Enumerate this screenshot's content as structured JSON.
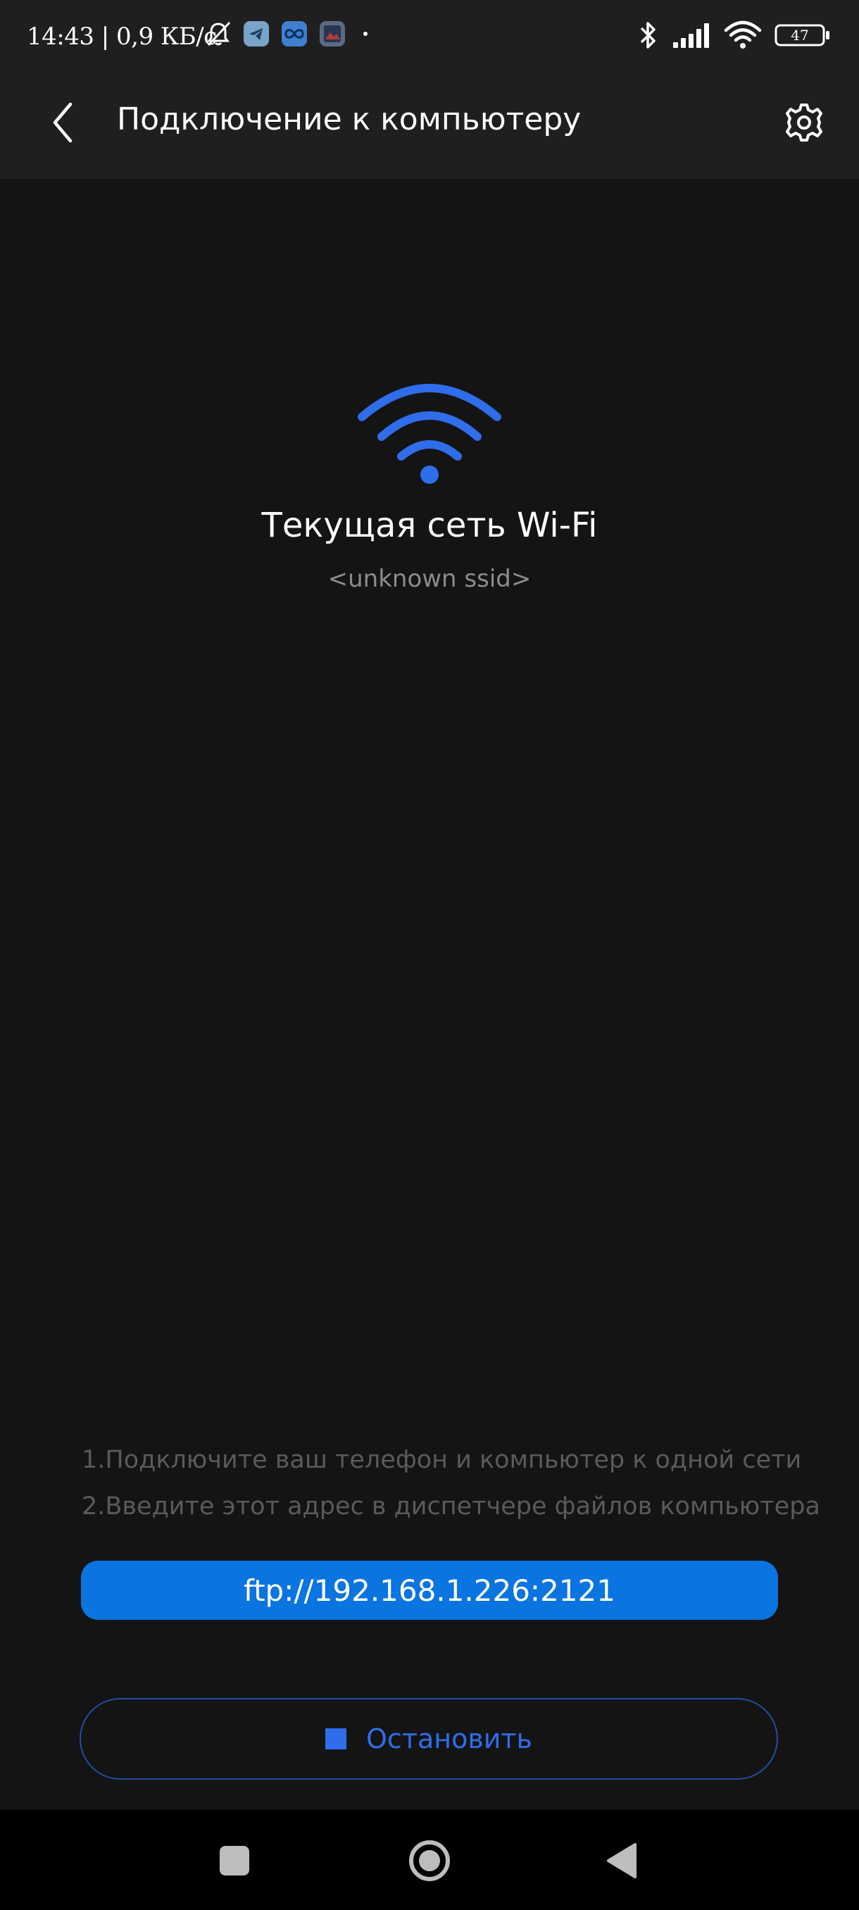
{
  "status_bar": {
    "time_speed": "14:43 | 0,9 КБ/с",
    "battery": "47",
    "icons_left": [
      "muted-alarm-icon",
      "telegram-icon",
      "infinity-app-icon",
      "photo-app-icon"
    ],
    "icons_right": [
      "bluetooth-icon",
      "signal-icon",
      "wifi-icon",
      "battery-icon"
    ]
  },
  "header": {
    "title": "Подключение к компьютеру",
    "back_icon": "chevron-left-icon",
    "settings_icon": "gear-icon"
  },
  "wifi": {
    "title": "Текущая сеть Wi-Fi",
    "ssid": "<unknown ssid>",
    "icon": "wifi-icon",
    "accent_color": "#2f6dea"
  },
  "instructions": [
    "1.Подключите ваш телефон и компьютер к одной сети",
    "2.Введите этот адрес в диспетчере файлов компьютера"
  ],
  "address": {
    "value": "ftp://192.168.1.226:2121",
    "color": "#0a74e0"
  },
  "stop_button": {
    "label": "Остановить",
    "icon": "stop-square-icon"
  },
  "nav_bar": {
    "buttons": [
      "recents-icon",
      "home-icon",
      "back-triangle-icon"
    ]
  }
}
